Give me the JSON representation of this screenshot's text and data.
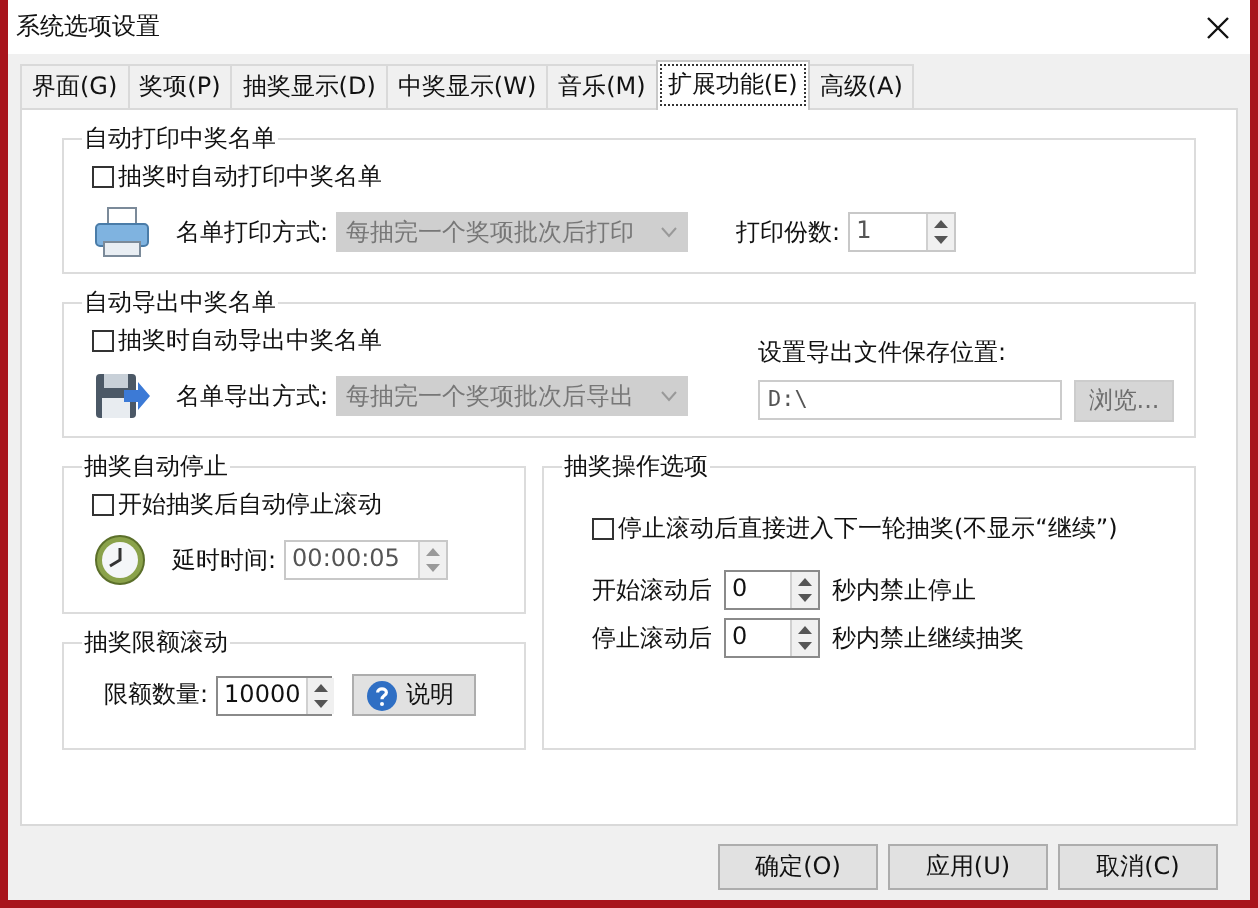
{
  "window": {
    "title": "系统选项设置"
  },
  "tabs": [
    {
      "label": "界面(G)",
      "selected": false
    },
    {
      "label": "奖项(P)",
      "selected": false
    },
    {
      "label": "抽奖显示(D)",
      "selected": false
    },
    {
      "label": "中奖显示(W)",
      "selected": false
    },
    {
      "label": "音乐(M)",
      "selected": false
    },
    {
      "label": "扩展功能(E)",
      "selected": true
    },
    {
      "label": "高级(A)",
      "selected": false
    }
  ],
  "print_group": {
    "title": "自动打印中奖名单",
    "checkbox": {
      "label": "抽奖时自动打印中奖名单",
      "checked": false
    },
    "method_label": "名单打印方式:",
    "method": {
      "value": "每抽完一个奖项批次后打印",
      "disabled": true
    },
    "copies_label": "打印份数:",
    "copies": {
      "value": "1",
      "disabled": true
    }
  },
  "export_group": {
    "title": "自动导出中奖名单",
    "checkbox": {
      "label": "抽奖时自动导出中奖名单",
      "checked": false
    },
    "method_label": "名单导出方式:",
    "method": {
      "value": "每抽完一个奖项批次后导出",
      "disabled": true
    },
    "path_label": "设置导出文件保存位置:",
    "path": {
      "value": "D:\\",
      "disabled": true
    },
    "browse": {
      "label": "浏览...",
      "disabled": true
    }
  },
  "stop_group": {
    "title": "抽奖自动停止",
    "checkbox": {
      "label": "开始抽奖后自动停止滚动",
      "checked": false
    },
    "delay_label": "延时时间:",
    "delay": {
      "value": "00:00:05",
      "disabled": true
    }
  },
  "limit_group": {
    "title": "抽奖限额滚动",
    "count_label": "限额数量:",
    "count": {
      "value": "10000",
      "disabled": false
    },
    "help": {
      "label": "说明"
    }
  },
  "ops_group": {
    "title": "抽奖操作选项",
    "checkbox": {
      "label": "停止滚动后直接进入下一轮抽奖(不显示“继续”)",
      "checked": false
    },
    "rows": [
      {
        "label": "开始滚动后",
        "value": "0",
        "suffix": "秒内禁止停止"
      },
      {
        "label": "停止滚动后",
        "value": "0",
        "suffix": "秒内禁止继续抽奖"
      }
    ]
  },
  "buttons": [
    "确定(O)",
    "应用(U)",
    "取消(C)"
  ]
}
